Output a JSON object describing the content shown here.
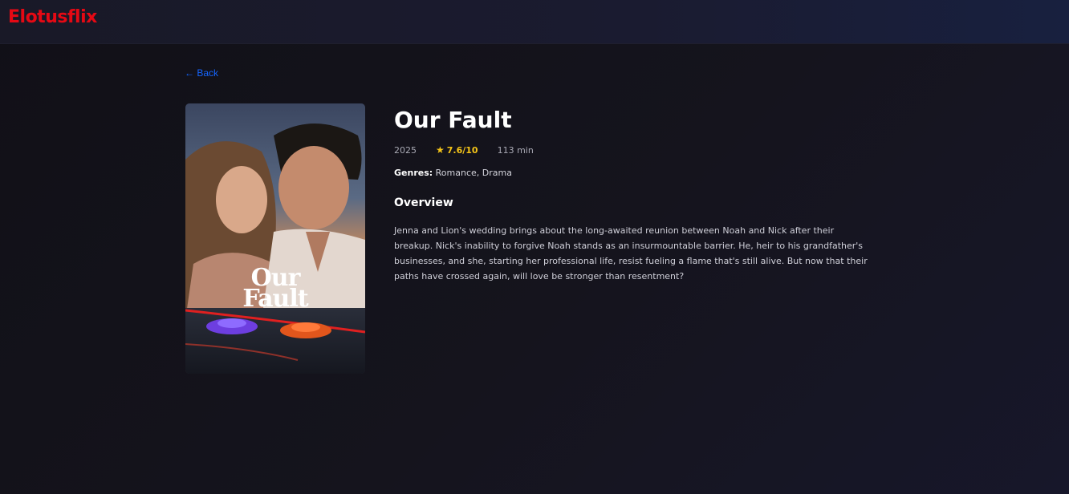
{
  "header": {
    "logo": "Elotusflix"
  },
  "nav": {
    "back_label": "← Back"
  },
  "poster": {
    "title_line1": "Our",
    "title_line2": "Fault"
  },
  "movie": {
    "title": "Our Fault",
    "year": "2025",
    "rating": "7.6/10",
    "runtime": "113 min",
    "genres_label": "Genres:",
    "genres": "Romance, Drama",
    "overview_heading": "Overview",
    "overview": "Jenna and Lion's wedding brings about the long-awaited reunion between Noah and Nick after their breakup. Nick's inability to forgive Noah stands as an insurmountable barrier. He, heir to his grandfather's businesses, and she, starting her professional life, resist fueling a flame that's still alive. But now that their paths have crossed again, will love be stronger than resentment?"
  },
  "colors": {
    "brand": "#e50914",
    "link": "#1565ff",
    "rating": "#f5c518",
    "background": "#121118"
  },
  "icons": {
    "rating": "star-icon"
  }
}
